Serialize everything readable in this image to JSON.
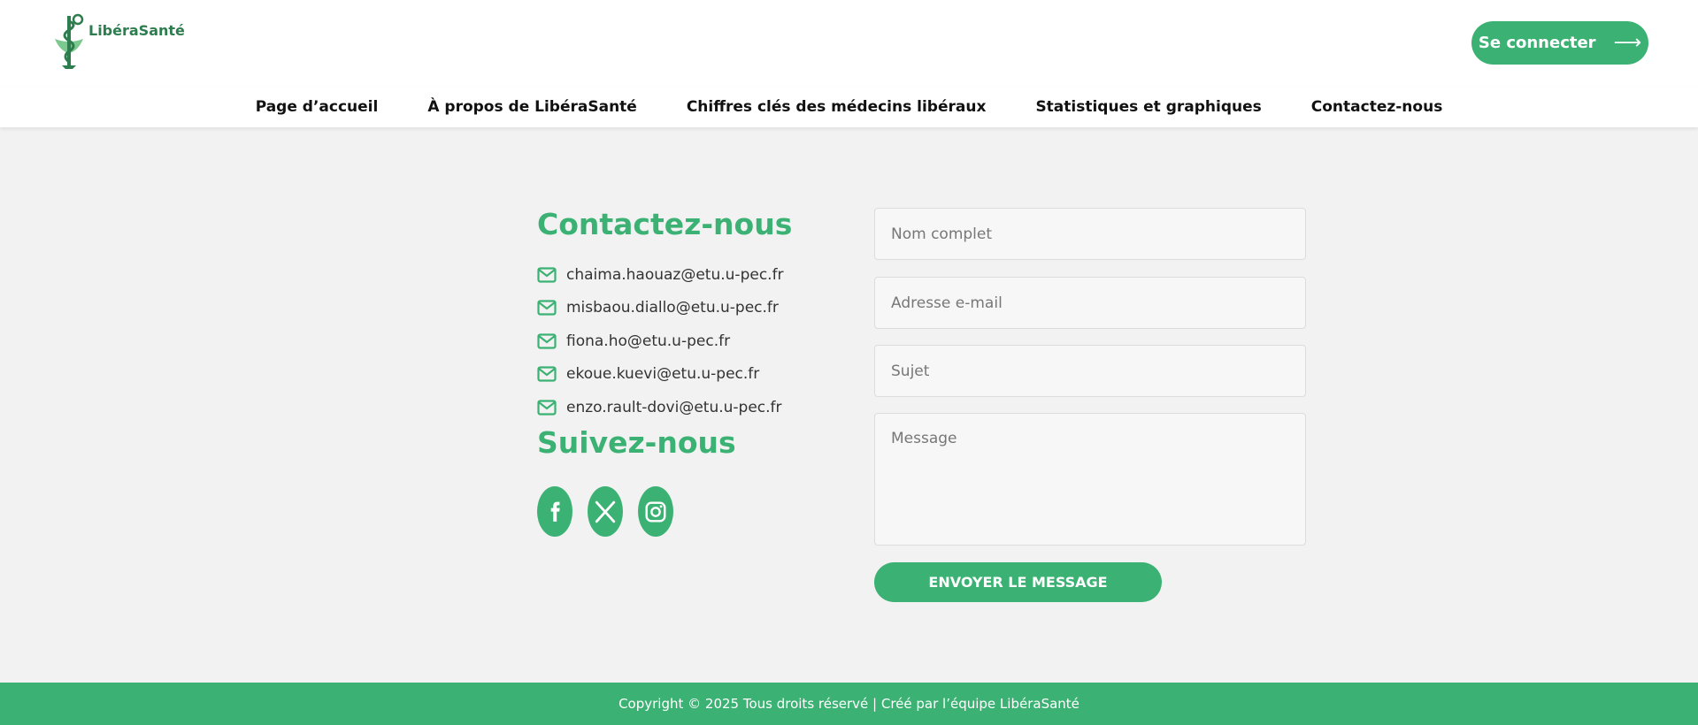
{
  "brand": {
    "name": "LibéraSanté",
    "color": "#3bb273"
  },
  "header": {
    "login_label": "Se connecter",
    "login_arrow": "⟶"
  },
  "nav": {
    "items": [
      {
        "label": "Page d’accueil"
      },
      {
        "label": "À propos de LibéraSanté"
      },
      {
        "label": "Chiffres clés des médecins libéraux"
      },
      {
        "label": "Statistiques et graphiques"
      },
      {
        "label": "Contactez-nous"
      }
    ]
  },
  "contact": {
    "title": "Contactez-nous",
    "emails": [
      "chaima.haouaz@etu.u-pec.fr",
      "misbaou.diallo@etu.u-pec.fr",
      "fiona.ho@etu.u-pec.fr",
      "ekoue.kuevi@etu.u-pec.fr",
      "enzo.rault-dovi@etu.u-pec.fr"
    ],
    "email_icon": "envelope-icon"
  },
  "follow": {
    "title": "Suivez-nous",
    "socials": [
      "facebook-icon",
      "x-icon",
      "instagram-icon"
    ]
  },
  "form": {
    "name_placeholder": "Nom complet",
    "email_placeholder": "Adresse e-mail",
    "subject_placeholder": "Sujet",
    "message_placeholder": "Message",
    "submit_label": "ENVOYER LE MESSAGE"
  },
  "footer": {
    "text": "Copyright © 2025 Tous droits réservé | Créé par l’équipe LibéraSanté"
  }
}
